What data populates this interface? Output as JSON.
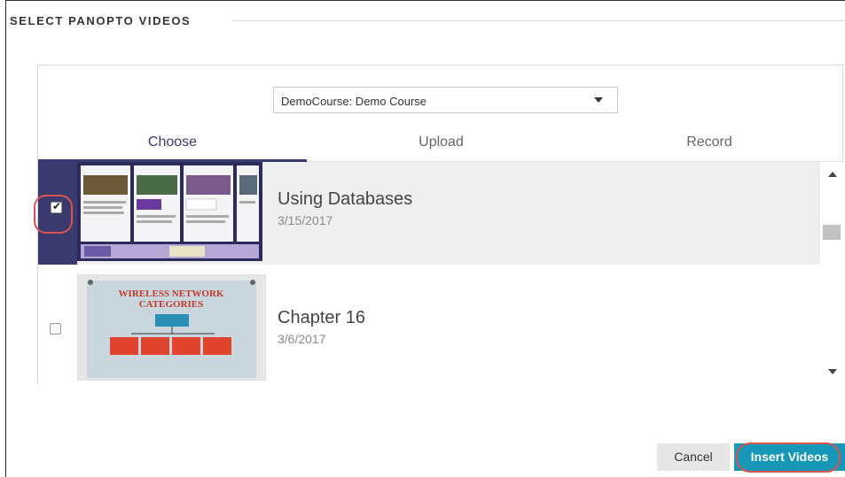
{
  "section": {
    "title": "SELECT PANOPTO VIDEOS"
  },
  "course_select": {
    "selected": "DemoCourse: Demo Course"
  },
  "tabs": [
    {
      "label": "Choose",
      "active": true
    },
    {
      "label": "Upload",
      "active": false
    },
    {
      "label": "Record",
      "active": false
    }
  ],
  "videos": [
    {
      "title": "Using Databases",
      "date": "3/15/2017",
      "checked": true,
      "thumbnail_text": []
    },
    {
      "title": "Chapter 16",
      "date": "3/6/2017",
      "checked": false,
      "thumbnail_text": [
        "WIRELESS NETWORK",
        "CATEGORIES"
      ]
    }
  ],
  "buttons": {
    "cancel": "Cancel",
    "insert": "Insert Videos"
  },
  "colors": {
    "accent": "#3b3a6e",
    "primary": "#1797b7",
    "highlight": "#d9534f"
  }
}
